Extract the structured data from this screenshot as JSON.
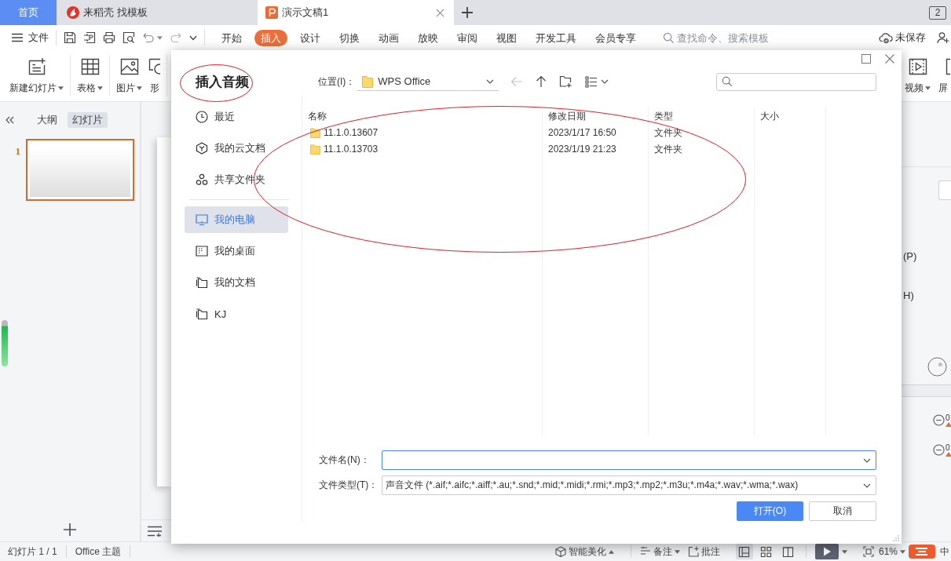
{
  "tabs": [
    {
      "label": "首页",
      "kind": "home",
      "selected": false
    },
    {
      "label": "来稻壳 找模板",
      "kind": "docer",
      "selected": false
    },
    {
      "label": "演示文稿1",
      "kind": "presentation",
      "selected": true
    }
  ],
  "window_count": "2",
  "menu": {
    "file": "文件",
    "tabs": [
      {
        "label": "开始",
        "selected": false
      },
      {
        "label": "插入",
        "selected": true
      },
      {
        "label": "设计",
        "selected": false
      },
      {
        "label": "切换",
        "selected": false
      },
      {
        "label": "动画",
        "selected": false
      },
      {
        "label": "放映",
        "selected": false
      },
      {
        "label": "审阅",
        "selected": false
      },
      {
        "label": "视图",
        "selected": false
      },
      {
        "label": "开发工具",
        "selected": false
      },
      {
        "label": "会员专享",
        "selected": false
      }
    ],
    "search": {
      "placeholder": "查找命令、搜索模板"
    },
    "save_status": "未保存"
  },
  "ribbon": {
    "left_groups": [
      {
        "items": [
          {
            "label": "新建幻灯片",
            "kind": "new-slide",
            "dropdown": true
          }
        ]
      },
      {
        "items": [
          {
            "label": "表格",
            "kind": "table",
            "dropdown": true
          }
        ]
      },
      {
        "items": [
          {
            "label": "图片",
            "kind": "picture",
            "dropdown": true
          },
          {
            "label": "形",
            "kind": "shape",
            "dropdown": false
          }
        ]
      }
    ],
    "right_items": [
      {
        "label": "视频",
        "kind": "video",
        "dropdown": true
      },
      {
        "label": "屏",
        "kind": "screen",
        "dropdown": false
      }
    ]
  },
  "slides_panel": {
    "tabs": [
      {
        "label": "大纲",
        "selected": false
      },
      {
        "label": "幻灯片",
        "selected": true
      }
    ],
    "slides": [
      {
        "number": "1",
        "selected": true
      }
    ]
  },
  "right_panel": {
    "labels": [
      "(P)",
      "H)"
    ],
    "steppers": [
      {
        "value": "0"
      },
      {
        "value": "0"
      }
    ]
  },
  "status_bar": {
    "slide_info": "幻灯片 1 / 1",
    "theme": "Office 主题",
    "beautify": "智能美化",
    "notes": "备注",
    "comments": "批注",
    "views": [
      {
        "kind": "normal",
        "selected": true
      },
      {
        "kind": "sorter",
        "selected": false
      },
      {
        "kind": "reading",
        "selected": false
      }
    ],
    "zoom": "61%",
    "input_method": "中"
  },
  "dialog": {
    "title": "插入音频",
    "title_circled": true,
    "location_label": "位置(I)：",
    "location": "WPS Office",
    "place_groups": [
      {
        "items": [
          {
            "label": "最近",
            "kind": "recent",
            "selected": false
          },
          {
            "label": "我的云文档",
            "kind": "cloud",
            "selected": false
          },
          {
            "label": "共享文件夹",
            "kind": "shared",
            "selected": false
          }
        ]
      },
      {
        "items": [
          {
            "label": "我的电脑",
            "kind": "computer",
            "selected": true
          },
          {
            "label": "我的桌面",
            "kind": "desktop",
            "selected": false
          },
          {
            "label": "我的文档",
            "kind": "documents",
            "selected": false
          },
          {
            "label": "KJ",
            "kind": "folder",
            "selected": false
          }
        ]
      }
    ],
    "columns": [
      "名称",
      "修改日期",
      "类型",
      "大小"
    ],
    "rows": [
      {
        "name": "11.1.0.13607",
        "modified": "2023/1/17 16:50",
        "type": "文件夹"
      },
      {
        "name": "11.1.0.13703",
        "modified": "2023/1/19 21:23",
        "type": "文件夹"
      }
    ],
    "list_circled": true,
    "filename": {
      "label": "文件名(N)：",
      "focused": true
    },
    "filetype": {
      "label": "文件类型(T)：",
      "value": "声音文件 (*.aif;*.aifc;*.aiff;*.au;*.snd;*.mid;*.midi;*.rmi;*.mp3;*.mp2;*.m3u;*.m4a;*.wav;*.wma;*.wax)"
    },
    "buttons": [
      {
        "label": "打开(O)",
        "kind": "primary"
      },
      {
        "label": "取消",
        "kind": "secondary"
      }
    ]
  }
}
